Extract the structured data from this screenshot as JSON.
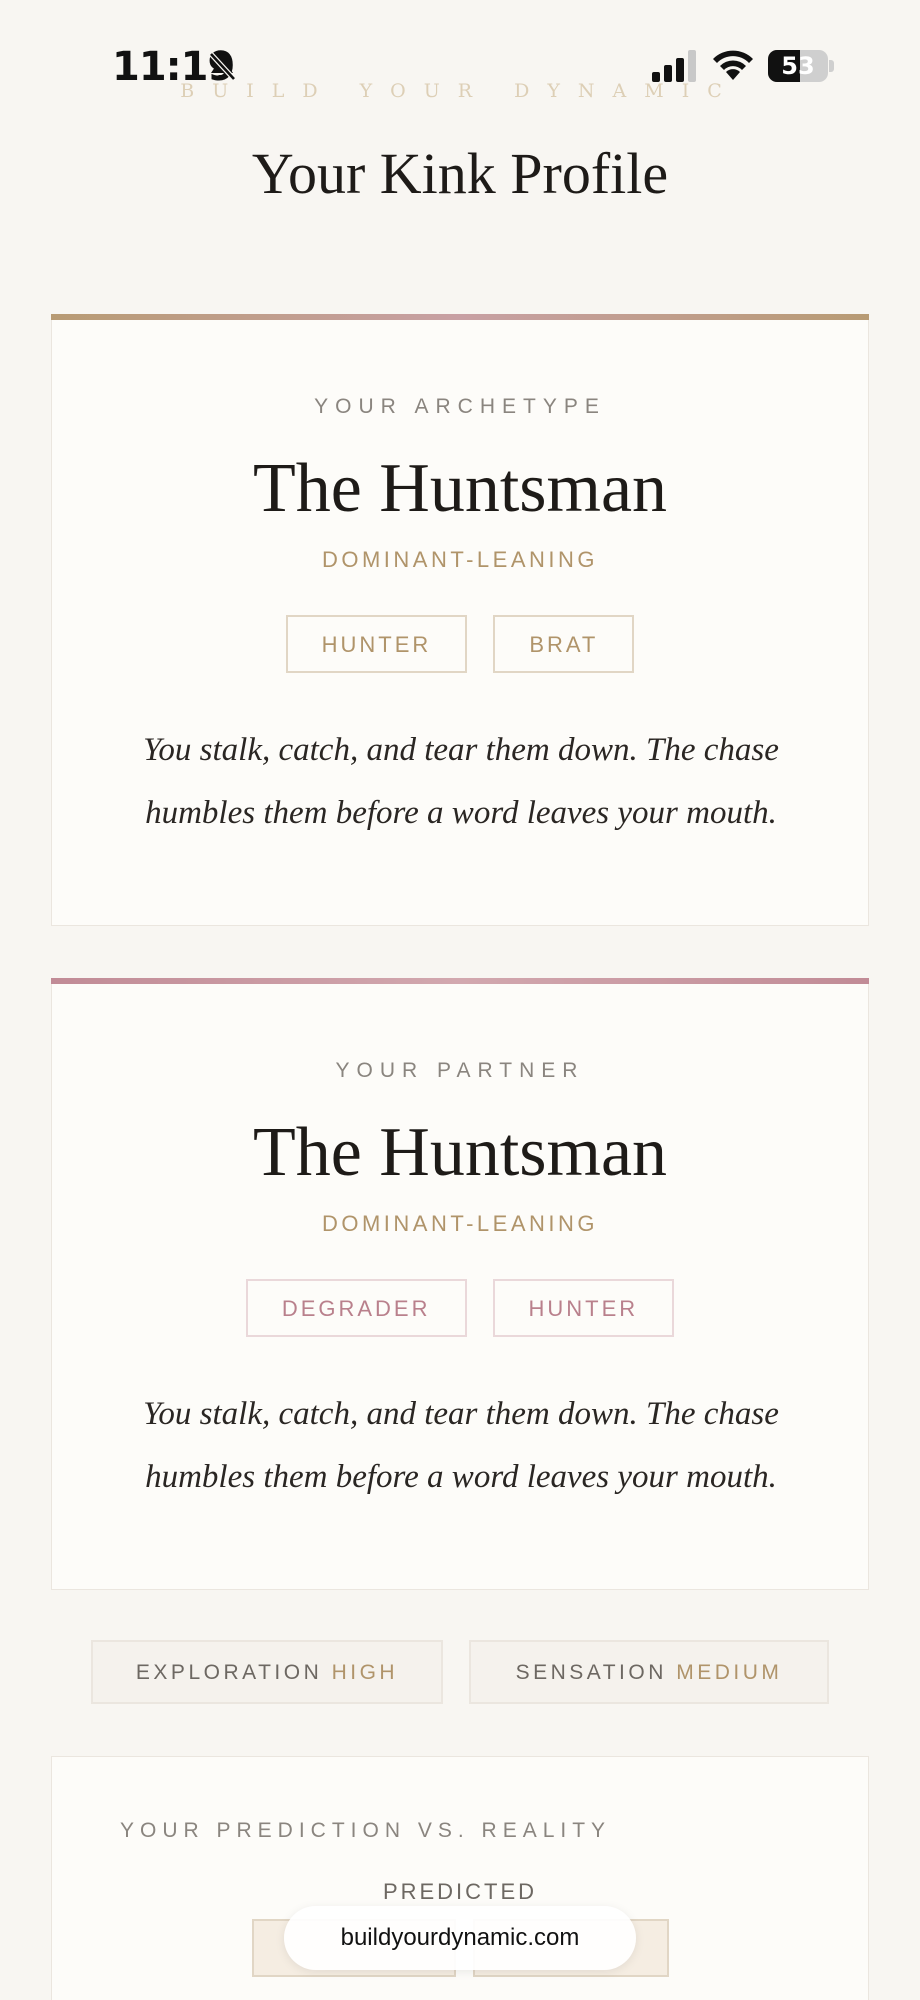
{
  "status_bar": {
    "time": "11:19",
    "battery": "53",
    "battery_level": 0.53
  },
  "header": {
    "eyebrow": "BUILD YOUR DYNAMIC",
    "title": "Your Kink Profile"
  },
  "archetype_card": {
    "label": "YOUR ARCHETYPE",
    "name": "The Huntsman",
    "leaning": "DOMINANT-LEANING",
    "tags": [
      "HUNTER",
      "BRAT"
    ],
    "description": "You stalk, catch, and tear them down. The chase humbles them before a word leaves your mouth."
  },
  "partner_card": {
    "label": "YOUR PARTNER",
    "name": "The Huntsman",
    "leaning": "DOMINANT-LEANING",
    "tags": [
      "DEGRADER",
      "HUNTER"
    ],
    "description": "You stalk, catch, and tear them down. The chase humbles them before a word leaves your mouth."
  },
  "levels": [
    {
      "label": "EXPLORATION",
      "value": "HIGH"
    },
    {
      "label": "SENSATION",
      "value": "MEDIUM"
    }
  ],
  "prediction": {
    "title": "YOUR PREDICTION VS. REALITY",
    "subtitle": "PREDICTED"
  },
  "browser": {
    "url": "buildyourdynamic.com"
  },
  "colors": {
    "gold": "#b0946a",
    "rose": "#b9808c",
    "background": "#f8f6f2"
  }
}
